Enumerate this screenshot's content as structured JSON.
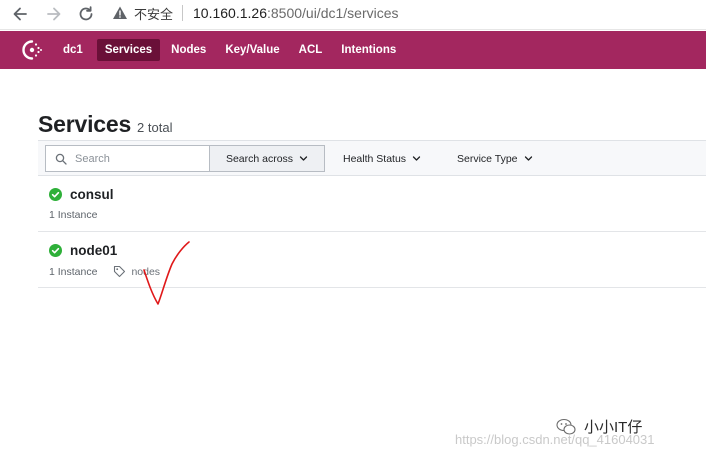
{
  "browser": {
    "insecure_label": "不安全",
    "url_host": "10.160.1.26",
    "url_path": ":8500/ui/dc1/services"
  },
  "topnav": {
    "datacenter": "dc1",
    "items": [
      "Services",
      "Nodes",
      "Key/Value",
      "ACL",
      "Intentions"
    ],
    "active": "Services"
  },
  "page": {
    "title": "Services",
    "total": "2 total"
  },
  "filters": {
    "search_placeholder": "Search",
    "search_across": "Search across",
    "health_status": "Health Status",
    "service_type": "Service Type"
  },
  "services": [
    {
      "name": "consul",
      "instances": "1 Instance",
      "status": "passing",
      "tag": ""
    },
    {
      "name": "node01",
      "instances": "1 Instance",
      "status": "passing",
      "tag": "nodes"
    }
  ],
  "watermark": {
    "name": "小小IT仔",
    "url": "https://blog.csdn.net/qq_41604031"
  },
  "colors": {
    "brand": "#a3275f",
    "brand_active": "#6a1038",
    "passing": "#2eb039",
    "annotation": "#e0191a"
  }
}
